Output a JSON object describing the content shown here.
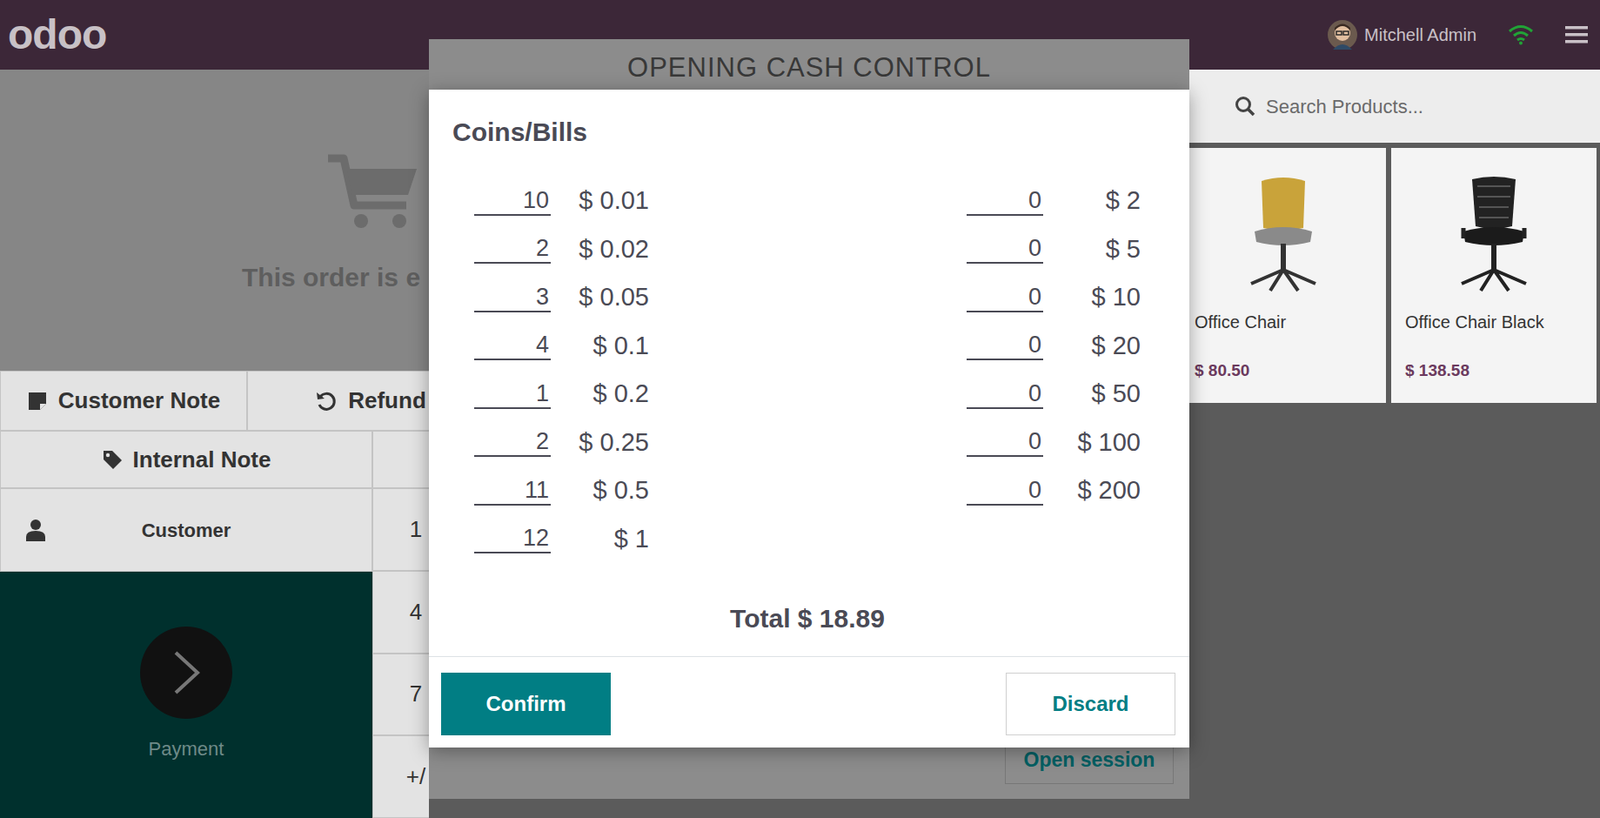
{
  "topbar": {
    "logo": "odoo",
    "user": "Mitchell Admin",
    "network": {
      "connected": true
    }
  },
  "order": {
    "empty_message": "This order is e"
  },
  "actions": [
    {
      "label": "Customer Note"
    },
    {
      "label": "Refund"
    },
    {
      "label": "Internal Note"
    }
  ],
  "customer": {
    "label": "Customer"
  },
  "payment": {
    "label": "Payment"
  },
  "numpad": [
    "1",
    "4",
    "7",
    "+/"
  ],
  "search": {
    "placeholder": "Search Products..."
  },
  "products": [
    {
      "name": "Office Chair",
      "price": "$ 80.50"
    },
    {
      "name": "Office Chair Black",
      "price": "$ 138.58"
    }
  ],
  "session_dialog": {
    "title": "OPENING CASH CONTROL",
    "button": "Open session"
  },
  "cash_dialog": {
    "title": "Coins/Bills",
    "left": [
      {
        "count": "10",
        "value": "$ 0.01"
      },
      {
        "count": "2",
        "value": "$ 0.02"
      },
      {
        "count": "3",
        "value": "$ 0.05"
      },
      {
        "count": "4",
        "value": "$ 0.1"
      },
      {
        "count": "1",
        "value": "$ 0.2"
      },
      {
        "count": "2",
        "value": "$ 0.25"
      },
      {
        "count": "11",
        "value": "$ 0.5"
      },
      {
        "count": "12",
        "value": "$ 1"
      }
    ],
    "right": [
      {
        "count": "0",
        "value": "$ 2"
      },
      {
        "count": "0",
        "value": "$ 5"
      },
      {
        "count": "0",
        "value": "$ 10"
      },
      {
        "count": "0",
        "value": "$ 20"
      },
      {
        "count": "0",
        "value": "$ 50"
      },
      {
        "count": "0",
        "value": "$ 100"
      },
      {
        "count": "0",
        "value": "$ 200"
      }
    ],
    "total": "Total $ 18.89",
    "buttons": [
      {
        "label": "Confirm",
        "kind": "primary"
      },
      {
        "label": "Discard",
        "kind": "secondary"
      }
    ]
  }
}
